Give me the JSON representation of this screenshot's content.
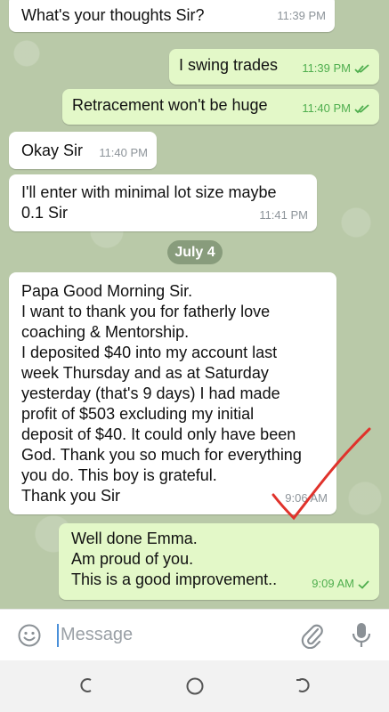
{
  "colors": {
    "chat_bg": "#b9c9a8",
    "incoming_bubble": "#ffffff",
    "outgoing_bubble": "#e3f8c8",
    "read_check": "#4fae4e",
    "annotation_red": "#e0322b"
  },
  "messages": [
    {
      "direction": "incoming",
      "text": "What's your thoughts Sir?",
      "time": "11:39 PM"
    },
    {
      "direction": "outgoing",
      "text": "I swing trades",
      "time": "11:39 PM",
      "status": "read"
    },
    {
      "direction": "outgoing",
      "text": "Retracement  won't be huge",
      "time": "11:40 PM",
      "status": "read"
    },
    {
      "direction": "incoming",
      "text": "Okay Sir",
      "time": "11:40 PM"
    },
    {
      "direction": "incoming",
      "text": "I'll enter with minimal lot size maybe\n0.1 Sir",
      "time": "11:41 PM"
    },
    {
      "direction": "incoming",
      "text": "Papa Good Morning Sir.\nI want to thank you for fatherly love\ncoaching & Mentorship.\nI deposited $40 into my account last\nweek Thursday and as at Saturday\nyesterday (that's 9 days) I had made\nprofit of $503 excluding my initial\ndeposit of $40. It could only have been\nGod. Thank you so much for everything\nyou do. This boy is grateful.\nThank you Sir",
      "time": "9:06 AM"
    },
    {
      "direction": "outgoing",
      "text": "Well done Emma.\nAm proud of you.\nThis is a good improvement..",
      "time": "9:09 AM",
      "status": "delivered"
    }
  ],
  "date_separator": "July 4",
  "composer": {
    "placeholder": "Message",
    "emoji_icon": "emoji-icon",
    "attach_icon": "paperclip-icon",
    "mic_icon": "microphone-icon"
  },
  "navigation": [
    "recent-apps-icon",
    "home-icon",
    "back-icon"
  ]
}
